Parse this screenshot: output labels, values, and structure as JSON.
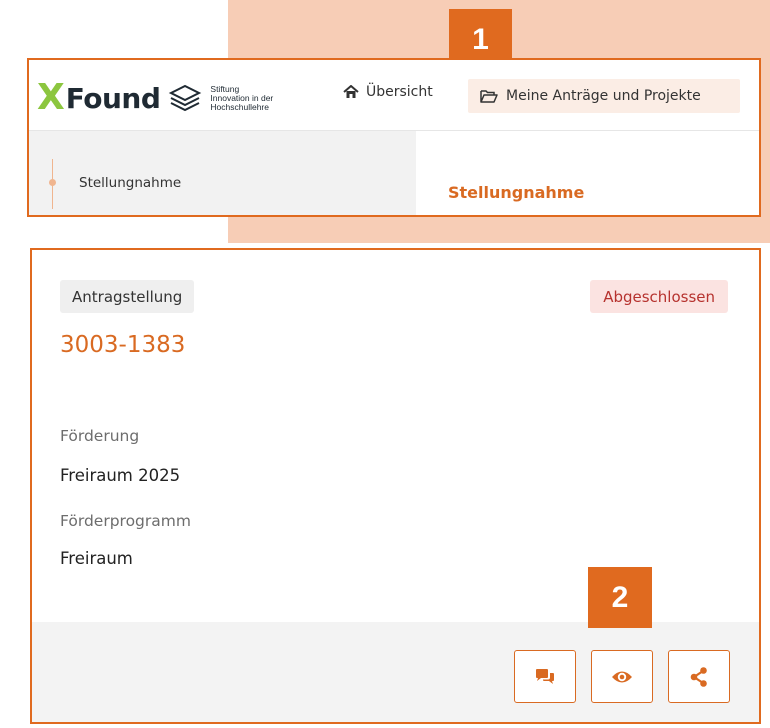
{
  "callouts": {
    "one": "1",
    "two": "2"
  },
  "logo": {
    "wordmark": "Found",
    "subtitle_line1": "Stiftung",
    "subtitle_line2": "Innovation in der",
    "subtitle_line3": "Hochschullehre"
  },
  "nav": {
    "overview_label": "Übersicht",
    "projects_label": "Meine Anträge und Projekte"
  },
  "subnav": {
    "left_item_label": "Stellungnahme",
    "section_title": "Stellungnahme"
  },
  "card": {
    "type_badge": "Antragstellung",
    "status_badge": "Abgeschlossen",
    "id": "3003-1383",
    "fields": [
      {
        "label": "Förderung",
        "value": "Freiraum 2025"
      },
      {
        "label": "Förderprogramm",
        "value": "Freiraum"
      }
    ],
    "actions": [
      "comments-icon",
      "eye-icon",
      "share-icon"
    ]
  },
  "colors": {
    "accent": "#e06a1f",
    "accent_text": "#d96a22",
    "peach_background": "#f7cdb6",
    "status_bg": "#fbe3e1",
    "status_text": "#b6322e",
    "logo_green": "#8cc63f"
  }
}
